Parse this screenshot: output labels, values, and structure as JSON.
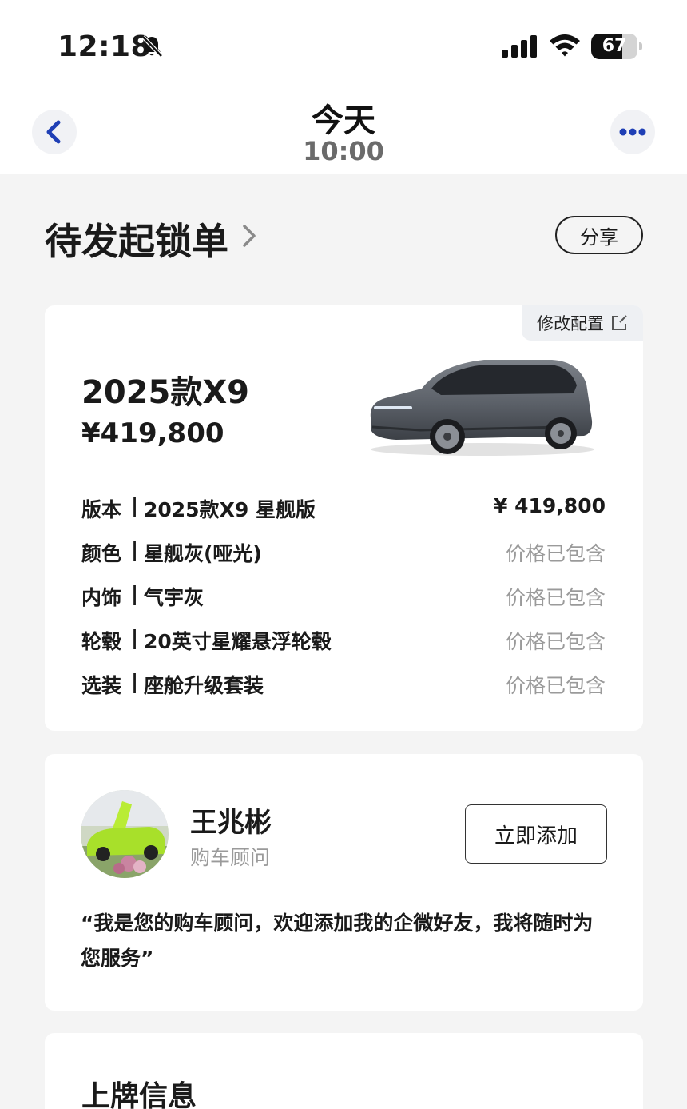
{
  "status_bar": {
    "time": "12:18",
    "battery_level": "67",
    "battery_fraction": 0.67
  },
  "nav": {
    "title": "今天",
    "subtitle": "10:00"
  },
  "section": {
    "title": "待发起锁单",
    "share_label": "分享"
  },
  "config_card": {
    "edit_label": "修改配置",
    "model_name": "2025款X9",
    "model_price": "¥419,800",
    "rows": [
      {
        "label": "版本",
        "sep": "|",
        "value": "2025款X9 星舰版",
        "price": "¥ 419,800"
      },
      {
        "label": "颜色",
        "sep": "|",
        "value": "星舰灰(哑光)",
        "price": "价格已包含"
      },
      {
        "label": "内饰",
        "sep": "|",
        "value": "气宇灰",
        "price": "价格已包含"
      },
      {
        "label": "轮毂",
        "sep": "|",
        "value": "20英寸星耀悬浮轮毂",
        "price": "价格已包含"
      },
      {
        "label": "选装",
        "sep": "|",
        "value": "座舱升级套装",
        "price": "价格已包含"
      }
    ]
  },
  "advisor": {
    "name": "王兆彬",
    "role": "购车顾问",
    "add_label": "立即添加",
    "quote": "“我是您的购车顾问，欢迎添加我的企微好友，我将随时为您服务”"
  },
  "plate": {
    "title": "上牌信息"
  },
  "colors": {
    "accent_blue": "#1f3fb5",
    "page_bg": "#f4f4f4",
    "muted_text": "#9a9a9a"
  },
  "icons": [
    "bell-slash-icon",
    "signal-icon",
    "wifi-icon",
    "battery-icon",
    "back-chevron-icon",
    "more-dots-icon",
    "chevron-right-icon",
    "external-edit-icon"
  ]
}
